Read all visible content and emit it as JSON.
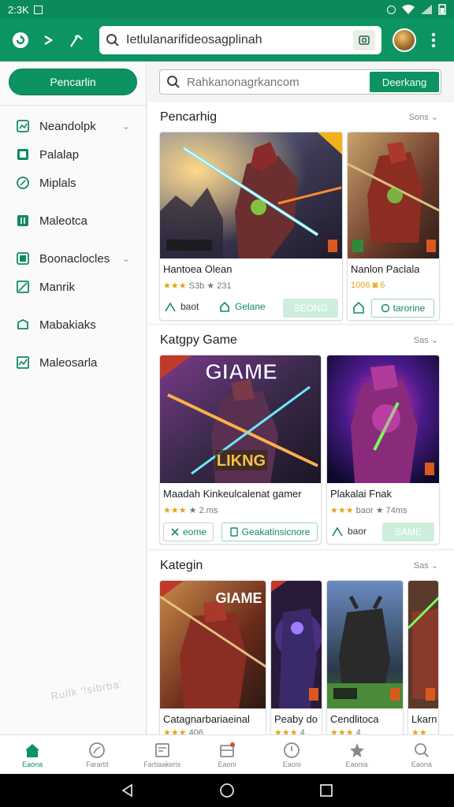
{
  "status_bar": {
    "time": "2:3K",
    "wifi_icon": "wifi-icon",
    "battery_icon": "battery-icon"
  },
  "app_bar": {
    "search_value": "Ietlulanarifideosagplinah",
    "icons": [
      "refresh-icon",
      "forward-icon",
      "share-icon",
      "search-icon",
      "camera-icon",
      "more-vert-icon"
    ]
  },
  "sidebar": {
    "primary_button": "Pencarlin",
    "items": [
      {
        "label": "Neandolpk",
        "icon": "grid-icon",
        "expandable": true
      },
      {
        "label": "Palalap",
        "icon": "image-icon",
        "expandable": false
      },
      {
        "label": "Miplals",
        "icon": "leaf-icon",
        "expandable": false
      },
      {
        "label": "Maleotca",
        "icon": "bars-icon",
        "expandable": false
      },
      {
        "label": "Boonaclocles",
        "icon": "list-icon",
        "expandable": true
      },
      {
        "label": "Manrik",
        "icon": "chart-icon",
        "expandable": false
      },
      {
        "label": "Mabakiaks",
        "icon": "stack-icon",
        "expandable": false
      },
      {
        "label": "Maleosarla",
        "icon": "graph-icon",
        "expandable": false
      }
    ],
    "watermark": "Ruilk '!sibrba' "
  },
  "main": {
    "search": {
      "placeholder": "Rahkanonagrkancom",
      "button": "Deerkang"
    },
    "sections": [
      {
        "title": "Pencarhig",
        "see_more": "Sons",
        "cards": [
          {
            "title": "Hantoea Olean",
            "rating": "★★★",
            "meta": "S3b ★ 231",
            "act1": "baot",
            "act2": "Gelane",
            "chip": "SEONG",
            "badge": "NEW"
          },
          {
            "title": "Nanlon Paclala",
            "rating": "",
            "meta": "1006 ◙ 6",
            "act1": "",
            "act2": "",
            "chip": "tarorine",
            "badge": ""
          }
        ]
      },
      {
        "title": "Katgpy Game",
        "see_more": "Sas",
        "cards": [
          {
            "title": "Maadah Kinkeulcalenat gamer",
            "rating": "★★★",
            "meta": "★ 2.ms",
            "act1": "eome",
            "act2": "Geakatinsicnore",
            "chip": "",
            "badge": "",
            "art_title": "GIAME",
            "art_sub": "LIKNG"
          },
          {
            "title": "Plakalai Fnak",
            "rating": "★★★",
            "meta": "baor ★ 74ms",
            "act1": "baor",
            "act2": "",
            "chip": "SAME",
            "badge": ""
          }
        ]
      },
      {
        "title": "Kategin",
        "see_more": "Sas",
        "cards": [
          {
            "title": "Catagnarbariaeinal",
            "rating": "★★★",
            "meta": "406",
            "art_title": "GIAME"
          },
          {
            "title": "Peaby do",
            "rating": "★★★",
            "meta": "4"
          },
          {
            "title": "Cendlitoca",
            "rating": "★★★",
            "meta": "4"
          },
          {
            "title": "Lkarn",
            "rating": "★★",
            "meta": ""
          }
        ]
      }
    ]
  },
  "bottom_nav": [
    {
      "label": "Eaona",
      "icon": "home-icon",
      "active": true
    },
    {
      "label": "Farartit",
      "icon": "compass-icon",
      "active": false
    },
    {
      "label": "Fartiaakeris",
      "icon": "doc-icon",
      "active": false
    },
    {
      "label": "Eaoni",
      "icon": "inbox-icon",
      "active": false
    },
    {
      "label": "Eaoni",
      "icon": "clock-icon",
      "active": false
    },
    {
      "label": "Eaonia",
      "icon": "star-icon",
      "active": false
    },
    {
      "label": "Eaona",
      "icon": "search-icon",
      "active": false
    }
  ],
  "colors": {
    "primary": "#0d9361",
    "status_bar": "#0b8a5c",
    "star": "#e6a412"
  }
}
